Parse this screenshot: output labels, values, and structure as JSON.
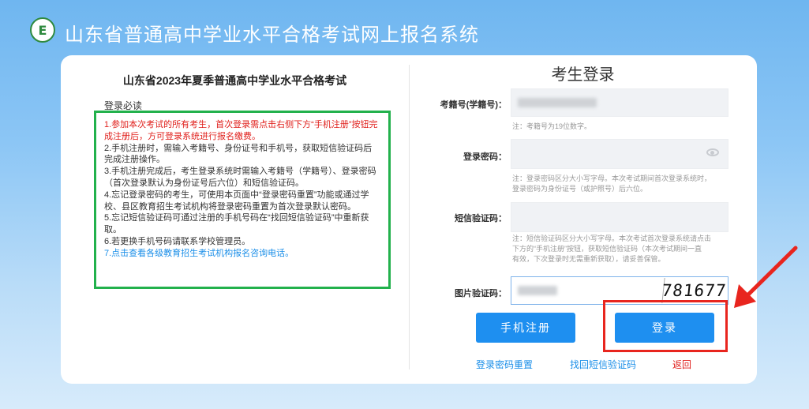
{
  "header": {
    "logo_letter": "E",
    "title": "山东省普通高中学业水平合格考试网上报名系统"
  },
  "left": {
    "title": "山东省2023年夏季普通高中学业水平合格考试",
    "notice_label": "登录必读",
    "notices": [
      "1.参加本次考试的所有考生，首次登录需点击右侧下方“手机注册”按钮完成注册后，方可登录系统进行报名缴费。",
      "2.手机注册时，需输入考籍号、身份证号和手机号，获取短信验证码后完成注册操作。",
      "3.手机注册完成后，考生登录系统时需输入考籍号（学籍号）、登录密码（首次登录默认为身份证号后六位）和短信验证码。",
      "4.忘记登录密码的考生，可使用本页面中“登录密码重置”功能或通过学校、县区教育招生考试机构将登录密码重置为首次登录默认密码。",
      "5.忘记短信验证码可通过注册的手机号码在“找回短信验证码”中重新获取。",
      "6.若更换手机号码请联系学校管理员。",
      "7.点击查看各级教育招生考试机构报名咨询电话。"
    ]
  },
  "login": {
    "title": "考生登录",
    "id_label": "考籍号(学籍号)：",
    "id_hint": "注：考籍号为19位数字。",
    "pwd_label": "登录密码：",
    "pwd_hint_1": "注：登录密码区分大小写字母。本次考试期间首次登录系统时，",
    "pwd_hint_2": "登录密码为身份证号（或护照号）后六位。",
    "sms_label": "短信验证码：",
    "sms_hint_1": "注：短信验证码区分大小写字母。本次考试首次登录系统请点击",
    "sms_hint_2": "下方的“手机注册”按钮，获取短信验证码（本次考试期间一直",
    "sms_hint_3": "有效，下次登录时无需重新获取），请妥善保管。",
    "captcha_label": "图片验证码：",
    "captcha_text": "781677",
    "register_button": "手机注册",
    "login_button": "登录",
    "reset_pwd_link": "登录密码重置",
    "recover_sms_link": "找回短信验证码",
    "back_link": "返回"
  },
  "colors": {
    "accent": "#1e8ff0",
    "notice_border": "#22b14c",
    "highlight": "#e8251e"
  }
}
